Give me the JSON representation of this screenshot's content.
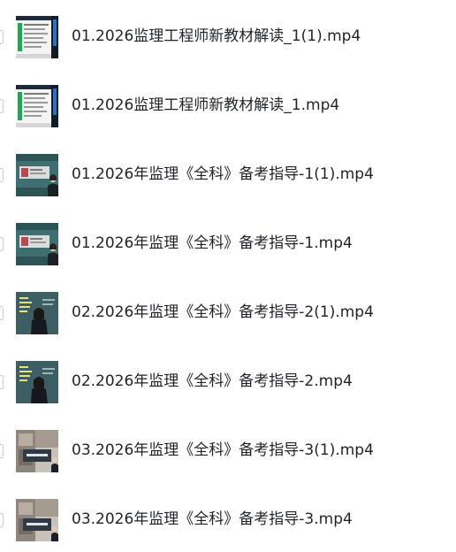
{
  "colors": {
    "text": "#1f2329",
    "checkbox_border": "#c7c9cc",
    "background": "#ffffff"
  },
  "files": [
    {
      "name": "01.2026监理工程师新教材解读_1(1).mp4",
      "thumbnail": "slide-document"
    },
    {
      "name": "01.2026监理工程师新教材解读_1.mp4",
      "thumbnail": "slide-document"
    },
    {
      "name": "01.2026年监理《全科》备考指导-1(1).mp4",
      "thumbnail": "lecturer-teal"
    },
    {
      "name": "01.2026年监理《全科》备考指导-1.mp4",
      "thumbnail": "lecturer-teal"
    },
    {
      "name": "02.2026年监理《全科》备考指导-2(1).mp4",
      "thumbnail": "lecturer-dark"
    },
    {
      "name": "02.2026年监理《全科》备考指导-2.mp4",
      "thumbnail": "lecturer-dark"
    },
    {
      "name": "03.2026年监理《全科》备考指导-3(1).mp4",
      "thumbnail": "lecturer-photo"
    },
    {
      "name": "03.2026年监理《全科》备考指导-3.mp4",
      "thumbnail": "lecturer-photo"
    }
  ]
}
